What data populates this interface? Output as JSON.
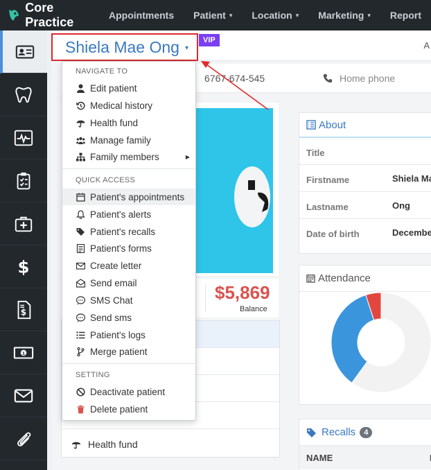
{
  "brand": {
    "name": "Core Practice"
  },
  "nav": [
    {
      "label": "Appointments",
      "caret": ""
    },
    {
      "label": "Patient",
      "caret": "▾"
    },
    {
      "label": "Location",
      "caret": "▾"
    },
    {
      "label": "Marketing",
      "caret": "▾"
    },
    {
      "label": "Report",
      "caret": ""
    }
  ],
  "sidebar": {
    "icons": [
      "id-card-icon",
      "tooth-icon",
      "heartbeat-icon",
      "clipboard-icon",
      "medkit-icon",
      "dollar-icon",
      "invoice-icon",
      "money-bill-icon",
      "envelope-icon",
      "paperclip-icon"
    ]
  },
  "patient": {
    "name": "Shiela Mae Ong",
    "caret": "▾",
    "vip": "VIP"
  },
  "header": {
    "right_text": "A"
  },
  "phone": {
    "number": "6767-674-545",
    "home_label": "Home phone"
  },
  "balance": {
    "value": "$5,869",
    "label": "Balance"
  },
  "health_fund_row": {
    "label": "Health fund"
  },
  "menu": {
    "navigate_header": "NAVIGATE TO",
    "navigate_items": [
      {
        "label": "Edit patient",
        "icon": "user-icon"
      },
      {
        "label": "Medical history",
        "icon": "history-icon"
      },
      {
        "label": "Health fund",
        "icon": "umbrella-icon"
      },
      {
        "label": "Manage family",
        "icon": "users-icon"
      },
      {
        "label": "Family members",
        "icon": "sitemap-icon",
        "submenu": "▶"
      }
    ],
    "quick_header": "QUICK ACCESS",
    "quick_items": [
      {
        "label": "Patient's appointments",
        "icon": "calendar-icon"
      },
      {
        "label": "Patient's alerts",
        "icon": "bell-icon"
      },
      {
        "label": "Patient's recalls",
        "icon": "tags-icon"
      },
      {
        "label": "Patient's forms",
        "icon": "form-icon"
      },
      {
        "label": "Create letter",
        "icon": "envelope-icon"
      },
      {
        "label": "Send email",
        "icon": "envelope-open-icon"
      },
      {
        "label": "SMS Chat",
        "icon": "sms-icon"
      },
      {
        "label": "Send sms",
        "icon": "sms-icon"
      },
      {
        "label": "Patient's logs",
        "icon": "list-icon"
      },
      {
        "label": "Merge patient",
        "icon": "code-branch-icon"
      }
    ],
    "setting_header": "SETTING",
    "setting_items": [
      {
        "label": "Deactivate patient",
        "icon": "ban-icon"
      },
      {
        "label": "Delete patient",
        "icon": "trash-icon"
      }
    ]
  },
  "about": {
    "title": "About",
    "rows": [
      {
        "label": "Title",
        "value": ""
      },
      {
        "label": "Firstname",
        "value": "Shiela Ma"
      },
      {
        "label": "Lastname",
        "value": "Ong"
      },
      {
        "label": "Date of birth",
        "value": "December"
      }
    ]
  },
  "attendance": {
    "title": "Attendance"
  },
  "recalls": {
    "title": "Recalls",
    "count": "4",
    "col_name": "NAME",
    "col_f": "F"
  },
  "colors": {
    "accent": "#3a79c1",
    "danger": "#d9534f",
    "vip": "#7b3ff2",
    "sidebar": "#23282d"
  },
  "chart_data": {
    "type": "pie",
    "title": "Attendance",
    "categories": [
      "",
      "",
      ""
    ],
    "values": [
      60,
      35,
      5
    ],
    "colors": [
      "#f2f2f2",
      "#3a95dd",
      "#e2473f"
    ],
    "donut": true
  }
}
